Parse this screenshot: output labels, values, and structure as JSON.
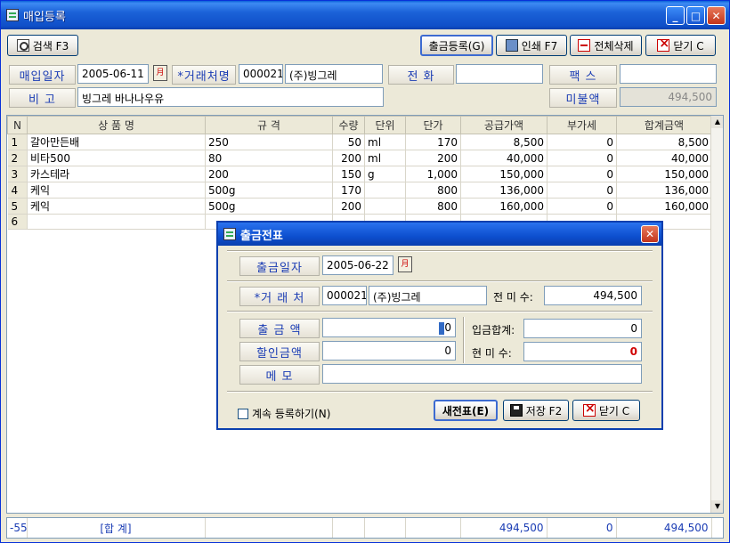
{
  "window": {
    "title": "매입등록"
  },
  "toolbar": {
    "search": "검색 F3",
    "outgoing": "출금등록(G)",
    "print": "인쇄 F7",
    "delete_all": "전체삭제",
    "close": "닫기 C"
  },
  "header": {
    "date_label": "매입일자",
    "date_value": "2005-06-11",
    "calendar_icon": "月",
    "vendor_label": "*거래처명",
    "vendor_code": "000021",
    "vendor_name": "(주)빙그레",
    "phone_label": "전  화",
    "phone_value": "",
    "fax_label": "팩  스",
    "fax_value": "",
    "memo_label": "비  고",
    "memo_value": "빙그레 바나나우유",
    "unpaid_label": "미불액",
    "unpaid_value": "494,500"
  },
  "grid": {
    "columns": [
      "N",
      "상 품 명",
      "규 격",
      "수량",
      "단위",
      "단가",
      "공급가액",
      "부가세",
      "합계금액"
    ],
    "rows": [
      [
        "1",
        "갈아만든배",
        "250",
        "50",
        "ml",
        "170",
        "8,500",
        "0",
        "8,500"
      ],
      [
        "2",
        "비타500",
        "80",
        "200",
        "ml",
        "200",
        "40,000",
        "0",
        "40,000"
      ],
      [
        "3",
        "카스테라",
        "200",
        "150",
        "g",
        "1,000",
        "150,000",
        "0",
        "150,000"
      ],
      [
        "4",
        "케익",
        "500g",
        "170",
        "",
        "800",
        "136,000",
        "0",
        "136,000"
      ],
      [
        "5",
        "케익",
        "500g",
        "200",
        "",
        "800",
        "160,000",
        "0",
        "160,000"
      ],
      [
        "6",
        "",
        "",
        "",
        "",
        "",
        "",
        "",
        ""
      ]
    ]
  },
  "footer": {
    "row_no": "-55",
    "label": "[합 계]",
    "supply": "494,500",
    "vat": "0",
    "total": "494,500"
  },
  "dialog": {
    "title": "출금전표",
    "date_label": "출금일자",
    "date_value": "2005-06-22",
    "vendor_label": "*거 래 처",
    "vendor_code": "000021",
    "vendor_name": "(주)빙그레",
    "prev_unpaid_label": "전 미 수:",
    "prev_unpaid_value": "494,500",
    "amount_label": "출  금  액",
    "amount_value": "0",
    "discount_label": "할인금액",
    "discount_value": "0",
    "memo_label": "메     모",
    "memo_value": "",
    "deposit_total_label": "입금합계:",
    "deposit_total_value": "0",
    "current_unpaid_label": "현 미 수:",
    "current_unpaid_value": "0",
    "continue_label": "계속 등록하기(N)",
    "new_btn": "새전표(E)",
    "save_btn": "저장 F2",
    "close_btn": "닫기 C"
  }
}
